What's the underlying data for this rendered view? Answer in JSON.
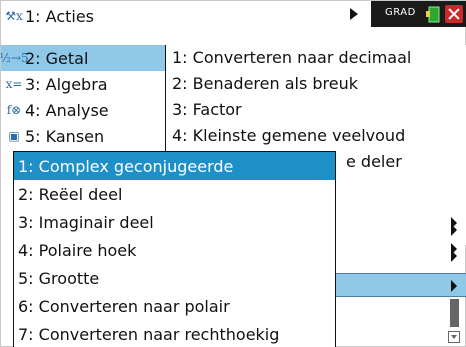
{
  "main_menu": {
    "items": [
      {
        "icon": "tools-icon",
        "glyph": "⚒x",
        "label": "1: Acties"
      },
      {
        "icon": "fraction-icon",
        "glyph": "½→5",
        "label": "2: Getal"
      },
      {
        "icon": "algebra-icon",
        "glyph": "x=",
        "label": "3: Algebra"
      },
      {
        "icon": "calculus-icon",
        "glyph": "f⊗",
        "label": "4: Analyse"
      },
      {
        "icon": "dice-icon",
        "glyph": "▣",
        "label": "5: Kansen"
      }
    ]
  },
  "status": {
    "angle_mode": "GRAD"
  },
  "number_menu": {
    "items": [
      {
        "label": "1: Converteren naar decimaal"
      },
      {
        "label": "2: Benaderen als breuk"
      },
      {
        "label": "3: Factor"
      },
      {
        "label": "4: Kleinste gemene veelvoud"
      },
      {
        "label": "e deler"
      }
    ]
  },
  "complex_menu": {
    "items": [
      {
        "label": "1: Complex geconjugeerde"
      },
      {
        "label": "2: Reëel deel"
      },
      {
        "label": "3: Imaginair deel"
      },
      {
        "label": "4: Polaire hoek"
      },
      {
        "label": "5: Grootte"
      },
      {
        "label": "6: Converteren naar polair"
      },
      {
        "label": "7: Converteren naar rechthoekig"
      }
    ]
  },
  "colors": {
    "selection_light": "#90c8e8",
    "selection_dark": "#1f8fc7",
    "close": "#c92a2a"
  }
}
